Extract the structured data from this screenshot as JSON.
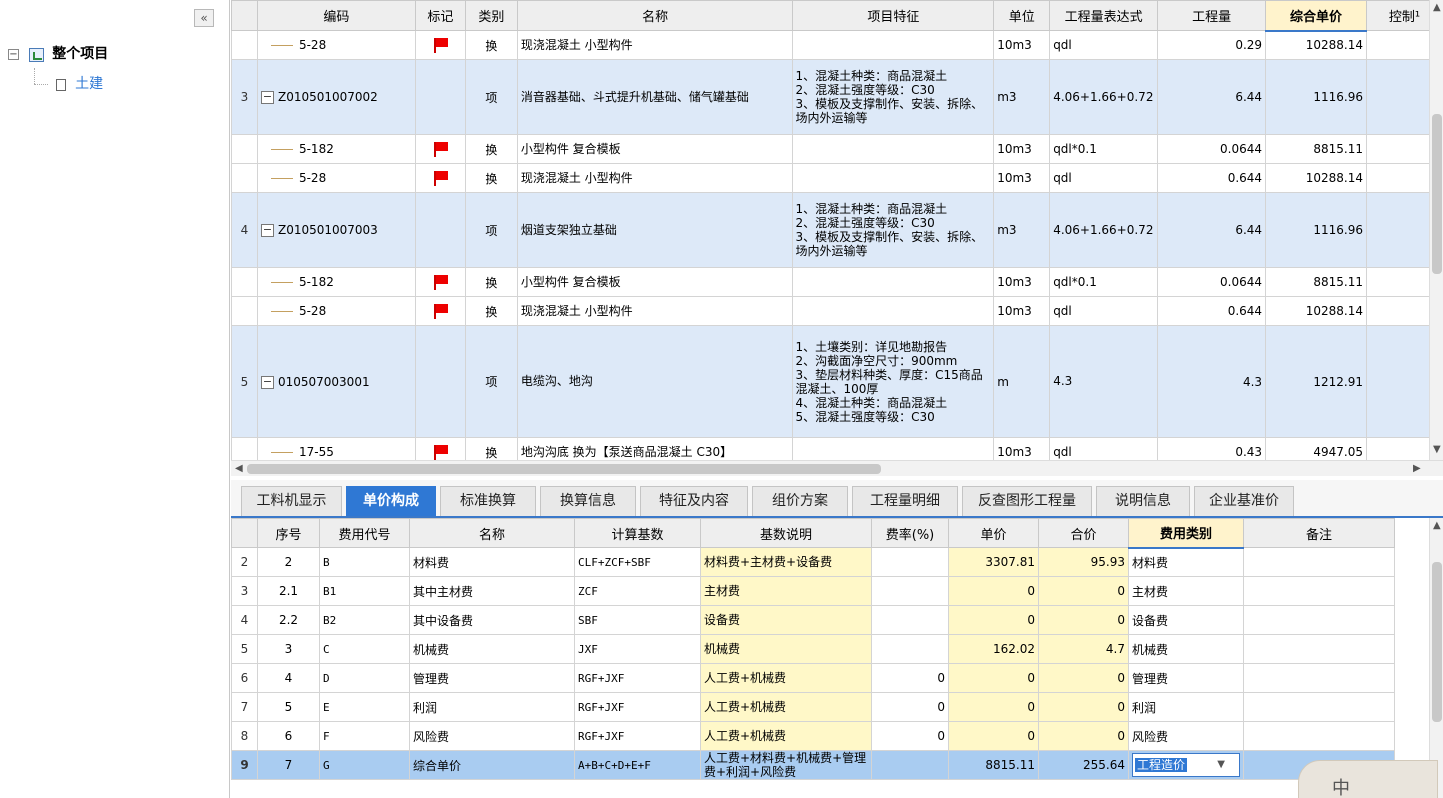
{
  "left_panel": {
    "collapse_label": "«",
    "tree": [
      {
        "label": "整个项目",
        "toggle": "−"
      },
      {
        "label": "土建"
      }
    ]
  },
  "top_table": {
    "columns": [
      "",
      "编码",
      "标记",
      "类别",
      "名称",
      "项目特征",
      "单位",
      "工程量表达式",
      "工程量",
      "综合单价",
      "控制¹"
    ],
    "selected_column": "综合单价",
    "rows": [
      {
        "no": "",
        "code": "5-28",
        "flag": true,
        "type": "换",
        "name": "现浇混凝土 小型构件",
        "feature": "",
        "unit": "10m3",
        "expr": "qdl",
        "qty": "0.29",
        "price": "10288.14",
        "sub": true
      },
      {
        "no": "3",
        "code": "Z010501007002",
        "flag": false,
        "type": "项",
        "name": "消音器基础、斗式提升机基础、储气罐基础",
        "feature": "1、混凝土种类：商品混凝土\n2、混凝土强度等级：C30\n3、模板及支撑制作、安装、拆除、场内外运输等",
        "unit": "m3",
        "expr": "4.06+1.66+0.72",
        "qty": "6.44",
        "price": "1116.96",
        "sub": false
      },
      {
        "no": "",
        "code": "5-182",
        "flag": true,
        "type": "换",
        "name": "小型构件 复合模板",
        "feature": "",
        "unit": "10m3",
        "expr": "qdl*0.1",
        "qty": "0.0644",
        "price": "8815.11",
        "sub": true
      },
      {
        "no": "",
        "code": "5-28",
        "flag": true,
        "type": "换",
        "name": "现浇混凝土 小型构件",
        "feature": "",
        "unit": "10m3",
        "expr": "qdl",
        "qty": "0.644",
        "price": "10288.14",
        "sub": true
      },
      {
        "no": "4",
        "code": "Z010501007003",
        "flag": false,
        "type": "项",
        "name": "烟道支架独立基础",
        "feature": "1、混凝土种类：商品混凝土\n2、混凝土强度等级：C30\n3、模板及支撑制作、安装、拆除、场内外运输等",
        "unit": "m3",
        "expr": "4.06+1.66+0.72",
        "qty": "6.44",
        "price": "1116.96",
        "sub": false
      },
      {
        "no": "",
        "code": "5-182",
        "flag": true,
        "type": "换",
        "name": "小型构件 复合模板",
        "feature": "",
        "unit": "10m3",
        "expr": "qdl*0.1",
        "qty": "0.0644",
        "price": "8815.11",
        "sub": true
      },
      {
        "no": "",
        "code": "5-28",
        "flag": true,
        "type": "换",
        "name": "现浇混凝土 小型构件",
        "feature": "",
        "unit": "10m3",
        "expr": "qdl",
        "qty": "0.644",
        "price": "10288.14",
        "sub": true
      },
      {
        "no": "5",
        "code": "010507003001",
        "flag": false,
        "type": "项",
        "name": "电缆沟、地沟",
        "feature": "1、土壤类别：详见地勘报告\n2、沟截面净空尺寸：900mm\n3、垫层材料种类、厚度：C15商品混凝土、100厚\n4、混凝土种类：商品混凝土\n5、混凝土强度等级：C30",
        "unit": "m",
        "expr": "4.3",
        "qty": "4.3",
        "price": "1212.91",
        "sub": false
      },
      {
        "no": "",
        "code": "17-55",
        "flag": true,
        "type": "换",
        "name": "地沟沟底 换为【泵送商品混凝土 C30】",
        "feature": "",
        "unit": "10m3",
        "expr": "qdl",
        "qty": "0.43",
        "price": "4947.05",
        "sub": true
      }
    ]
  },
  "tabs": [
    "工料机显示",
    "单价构成",
    "标准换算",
    "换算信息",
    "特征及内容",
    "组价方案",
    "工程量明细",
    "反查图形工程量",
    "说明信息",
    "企业基准价"
  ],
  "active_tab": "单价构成",
  "bottom_table": {
    "columns": [
      "",
      "序号",
      "费用代号",
      "名称",
      "计算基数",
      "基数说明",
      "费率(%)",
      "单价",
      "合价",
      "费用类别",
      "备注"
    ],
    "selected_column": "费用类别",
    "rows": [
      {
        "rn": "2",
        "seq": "2",
        "code": "B",
        "name": "材料费",
        "base": "CLF+ZCF+SBF",
        "desc": "材料费+主材费+设备费",
        "rate": "",
        "price": "3307.81",
        "total": "95.93",
        "cat": "材料费",
        "note": ""
      },
      {
        "rn": "3",
        "seq": "2.1",
        "code": "B1",
        "name": "其中主材费",
        "base": "ZCF",
        "desc": "主材费",
        "rate": "",
        "price": "0",
        "total": "0",
        "cat": "主材费",
        "note": ""
      },
      {
        "rn": "4",
        "seq": "2.2",
        "code": "B2",
        "name": "其中设备费",
        "base": "SBF",
        "desc": "设备费",
        "rate": "",
        "price": "0",
        "total": "0",
        "cat": "设备费",
        "note": ""
      },
      {
        "rn": "5",
        "seq": "3",
        "code": "C",
        "name": "机械费",
        "base": "JXF",
        "desc": "机械费",
        "rate": "",
        "price": "162.02",
        "total": "4.7",
        "cat": "机械费",
        "note": ""
      },
      {
        "rn": "6",
        "seq": "4",
        "code": "D",
        "name": "管理费",
        "base": "RGF+JXF",
        "desc": "人工费+机械费",
        "rate": "0",
        "price": "0",
        "total": "0",
        "cat": "管理费",
        "note": ""
      },
      {
        "rn": "7",
        "seq": "5",
        "code": "E",
        "name": "利润",
        "base": "RGF+JXF",
        "desc": "人工费+机械费",
        "rate": "0",
        "price": "0",
        "total": "0",
        "cat": "利润",
        "note": ""
      },
      {
        "rn": "8",
        "seq": "6",
        "code": "F",
        "name": "风险费",
        "base": "RGF+JXF",
        "desc": "人工费+机械费",
        "rate": "0",
        "price": "0",
        "total": "0",
        "cat": "风险费",
        "note": ""
      },
      {
        "rn": "9",
        "seq": "7",
        "code": "G",
        "name": "综合单价",
        "base": "A+B+C+D+E+F",
        "desc": "人工费+材料费+机械费+管理费+利润+风险费",
        "rate": "",
        "price": "8815.11",
        "total": "255.64",
        "cat": "工程造价",
        "note": "",
        "selected": true
      }
    ]
  },
  "assistant_label": "中"
}
